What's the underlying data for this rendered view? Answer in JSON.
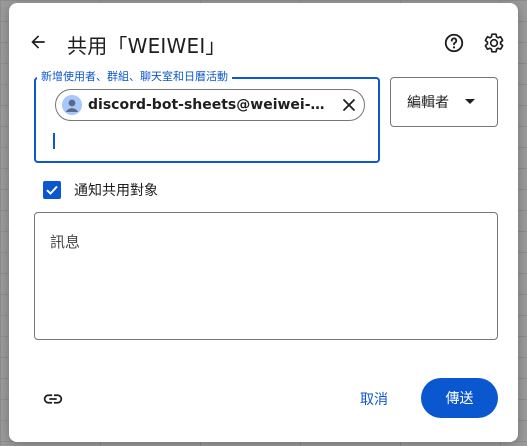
{
  "dialog": {
    "title": "共用「WEIWEI」",
    "back_icon": "arrow-left-icon",
    "help_icon": "help-circle-icon",
    "settings_icon": "gear-icon"
  },
  "add_people": {
    "label": "新增使用者、群組、聊天室和日曆活動",
    "chip_text": "discord-bot-sheets@weiwei-491108...",
    "chip_icon": "person-avatar-icon",
    "remove_icon": "close-icon",
    "input_value": ""
  },
  "role": {
    "selected": "編輯者",
    "arrow_icon": "triangle-down-icon"
  },
  "notify": {
    "checked": true,
    "label": "通知共用對象"
  },
  "message": {
    "placeholder": "訊息",
    "value": ""
  },
  "footer": {
    "link_icon": "link-icon",
    "cancel_label": "取消",
    "send_label": "傳送"
  },
  "colors": {
    "accent": "#0b57d0",
    "text": "#1f1f1f",
    "border": "#747775"
  }
}
